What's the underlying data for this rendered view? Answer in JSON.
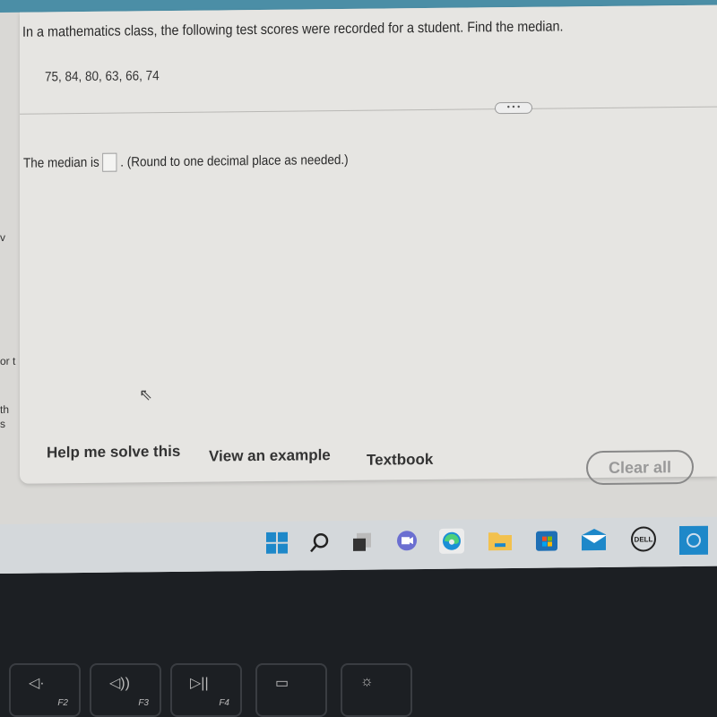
{
  "sidebar_fragments": [
    "v",
    "or t",
    "th",
    "s"
  ],
  "question": {
    "prompt": "In a mathematics class, the following test scores were recorded for a student. Find the median.",
    "scores": "75, 84, 80, 63, 66, 74",
    "more_button": "• • •",
    "answer_prefix": "The median is",
    "answer_value": "",
    "answer_suffix": ". (Round to one decimal place as needed.)"
  },
  "actions": {
    "help": "Help me solve this",
    "example": "View an example",
    "textbook": "Textbook",
    "clear": "Clear all"
  },
  "taskbar": {
    "icons": [
      "windows-start-icon",
      "search-icon",
      "task-view-icon",
      "teams-chat-icon",
      "edge-icon",
      "file-explorer-icon",
      "store-icon",
      "mail-icon",
      "dell-icon",
      "cortana-icon"
    ],
    "dell_label": "DELL"
  },
  "keyboard": {
    "keys": [
      {
        "label": "F2",
        "icon": "mute-icon"
      },
      {
        "label": "F3",
        "icon": "volume-up-icon"
      },
      {
        "label": "F4",
        "icon": "play-pause-icon"
      },
      {
        "label": "",
        "icon": "keyboard-backlight-icon"
      },
      {
        "label": "",
        "icon": "brightness-icon"
      }
    ]
  },
  "colors": {
    "topbar": "#4b8ea6",
    "panel": "#e6e5e2",
    "accent_blue": "#1e88c9"
  }
}
